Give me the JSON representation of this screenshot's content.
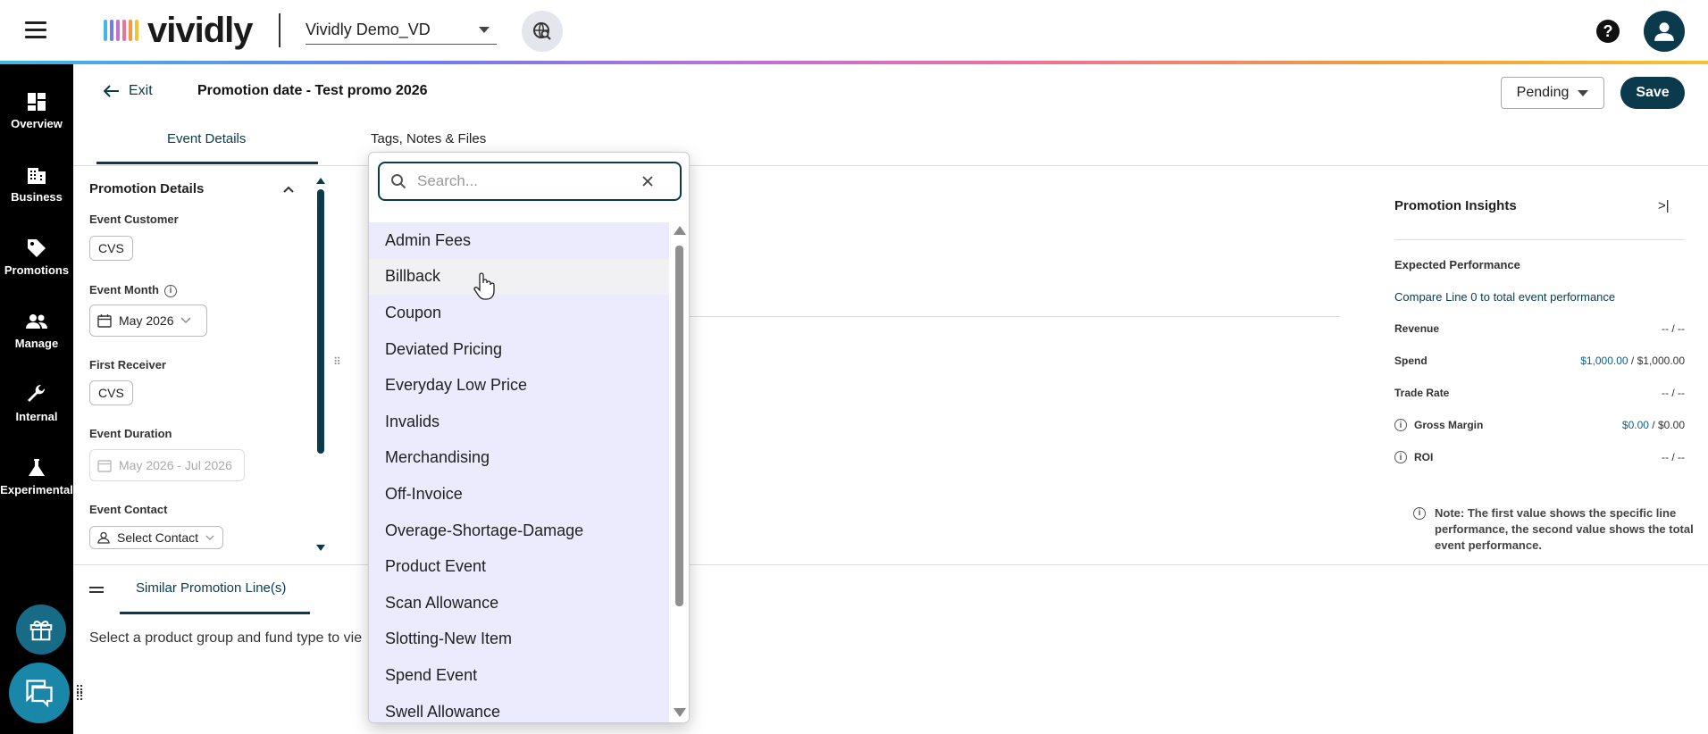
{
  "app": {
    "logo_text": "vividly",
    "org_name": "Vividly Demo_VD",
    "help_glyph": "?",
    "brand_color": "#0c3a4d"
  },
  "nav": {
    "items": [
      {
        "label": "Overview",
        "icon": "overview-grid-icon"
      },
      {
        "label": "Business",
        "icon": "building-icon"
      },
      {
        "label": "Promotions",
        "icon": "tag-icon"
      },
      {
        "label": "Manage",
        "icon": "people-icon"
      },
      {
        "label": "Internal",
        "icon": "wrench-icon"
      },
      {
        "label": "Experimental",
        "icon": "flask-icon"
      }
    ]
  },
  "header": {
    "exit_label": "Exit",
    "title": "Promotion date - Test promo 2026",
    "status": "Pending",
    "save_label": "Save"
  },
  "tabs": [
    {
      "label": "Event Details",
      "active": true
    },
    {
      "label": "Tags, Notes & Files",
      "active": false
    }
  ],
  "details": {
    "title": "Promotion Details",
    "customer_label": "Event Customer",
    "customer_value": "CVS",
    "month_label": "Event Month",
    "month_value": "May 2026",
    "receiver_label": "First Receiver",
    "receiver_value": "CVS",
    "duration_label": "Event Duration",
    "duration_value": "May 2026 - Jul 2026",
    "contact_label": "Event Contact",
    "contact_value": "Select Contact"
  },
  "bottom": {
    "tab_label": "Similar Promotion Line(s)",
    "message": "Select a product group and fund type to vie"
  },
  "insights": {
    "title": "Promotion Insights",
    "collapse_glyph": ">|",
    "subtitle": "Expected Performance",
    "compare": "Compare Line 0 to total event performance",
    "metrics": [
      {
        "label": "Revenue",
        "line": "--",
        "total": "--",
        "info": false
      },
      {
        "label": "Spend",
        "line": "$1,000.00",
        "total": "$1,000.00",
        "info": false
      },
      {
        "label": "Trade Rate",
        "line": "--",
        "total": "--",
        "info": false
      },
      {
        "label": "Gross Margin",
        "line": "$0.00",
        "total": "$0.00",
        "info": true
      },
      {
        "label": "ROI",
        "line": "--",
        "total": "--",
        "info": true
      }
    ],
    "note": "Note: The first value shows the specific line performance, the second value shows the total event performance."
  },
  "dropdown": {
    "search_placeholder": "Search...",
    "options": [
      "Admin Fees",
      "Billback",
      "Coupon",
      "Deviated Pricing",
      "Everyday Low Price",
      "Invalids",
      "Merchandising",
      "Off-Invoice",
      "Overage-Shortage-Damage",
      "Product Event",
      "Scan Allowance",
      "Slotting-New Item",
      "Spend Event",
      "Swell Allowance"
    ],
    "hovered_option": "Billback"
  }
}
